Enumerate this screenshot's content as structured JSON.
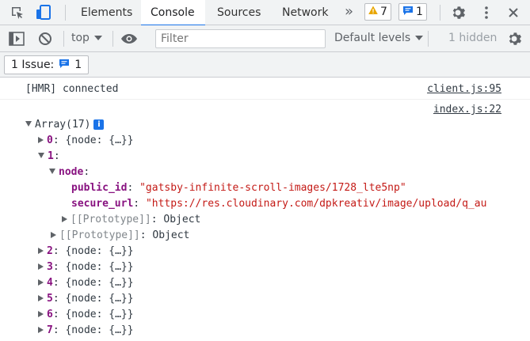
{
  "tabs": [
    {
      "label": "Elements"
    },
    {
      "label": "Console"
    },
    {
      "label": "Sources"
    },
    {
      "label": "Network"
    }
  ],
  "tabbar": {
    "more_tabs": "»",
    "warning_count": "7",
    "message_count": "1"
  },
  "toolbar": {
    "context": "top",
    "filter_placeholder": "Filter",
    "levels": "Default levels",
    "hidden": "1 hidden"
  },
  "issues": {
    "label": "1 Issue:",
    "count": "1"
  },
  "console": {
    "hmr_text": "[HMR] connected",
    "hmr_source": "client.js:95",
    "array_source": "index.js:22",
    "array_label": "Array(17)",
    "info_badge": "i",
    "item0_key": "0",
    "item0_value": "{node: {…}}",
    "item1_key": "1",
    "node_key": "node",
    "public_id_key": "public_id",
    "public_id_value": "\"gatsby-infinite-scroll-images/1728_lte5np\"",
    "secure_url_key": "secure_url",
    "secure_url_value": "\"https://res.cloudinary.com/dpkreativ/image/upload/q_au",
    "prototype_label": "[[Prototype]]",
    "prototype_value": "Object",
    "items": [
      {
        "key": "2",
        "value": "{node: {…}}"
      },
      {
        "key": "3",
        "value": "{node: {…}}"
      },
      {
        "key": "4",
        "value": "{node: {…}}"
      },
      {
        "key": "5",
        "value": "{node: {…}}"
      },
      {
        "key": "6",
        "value": "{node: {…}}"
      },
      {
        "key": "7",
        "value": "{node: {…}}"
      }
    ]
  }
}
